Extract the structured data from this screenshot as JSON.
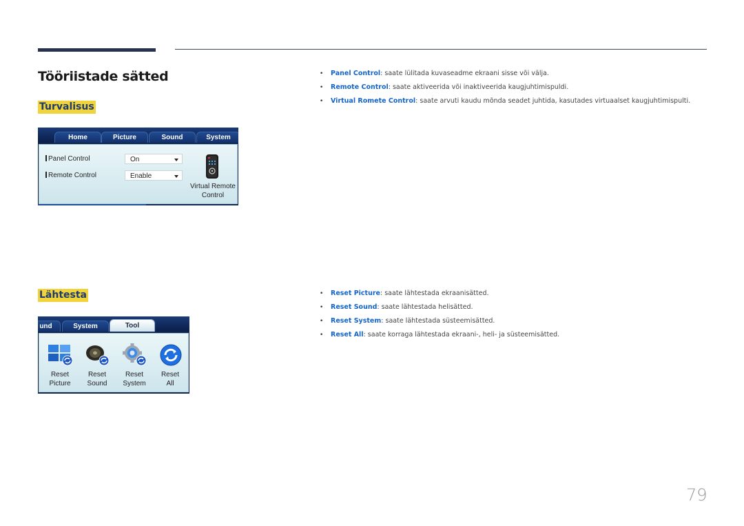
{
  "page": {
    "title": "Tööriistade sätted",
    "page_number": "79"
  },
  "security": {
    "label": "Turvalisus",
    "panel": {
      "tabs": [
        "Home",
        "Picture",
        "Sound",
        "System"
      ],
      "rows": [
        {
          "label": "Panel Control",
          "value": "On"
        },
        {
          "label": "Remote Control",
          "value": "Enable"
        }
      ],
      "virtual_remote": {
        "line1": "Virtual Remote",
        "line2": "Control",
        "icon": "remote-control-icon"
      }
    },
    "bullets": [
      {
        "term": "Panel Control",
        "text": ": saate lülitada kuvaseadme ekraani sisse või välja."
      },
      {
        "term": "Remote Control",
        "text": ": saate aktiveerida või inaktiveerida kaugjuhtimispuldi."
      },
      {
        "term": "Virtual Romete Control",
        "text": ": saate arvuti kaudu mõnda seadet juhtida, kasutades virtuaalset kaugjuhtimispulti."
      }
    ]
  },
  "reset": {
    "label": "Lähtesta",
    "panel": {
      "tabs": [
        "und",
        "System",
        "Tool"
      ],
      "active_tab": "Tool",
      "items": [
        {
          "line1": "Reset",
          "line2": "Picture",
          "icon": "reset-picture-icon"
        },
        {
          "line1": "Reset",
          "line2": "Sound",
          "icon": "reset-sound-icon"
        },
        {
          "line1": "Reset",
          "line2": "System",
          "icon": "reset-system-icon"
        },
        {
          "line1": "Reset",
          "line2": "All",
          "icon": "reset-all-icon"
        }
      ]
    },
    "bullets": [
      {
        "term": "Reset Picture",
        "text": ": saate lähtestada ekraanisätted."
      },
      {
        "term": "Reset Sound",
        "text": ": saate lähtestada helisätted."
      },
      {
        "term": "Reset System",
        "text": ": saate lähtestada süsteemisätted."
      },
      {
        "term": "Reset All",
        "text": ": saate korraga lähtestada ekraani-, heli- ja süsteemisätted."
      }
    ]
  },
  "colors": {
    "term_blue": "#1464c8",
    "highlight_yellow": "#f0d43a",
    "header_navy": "#26304f"
  }
}
